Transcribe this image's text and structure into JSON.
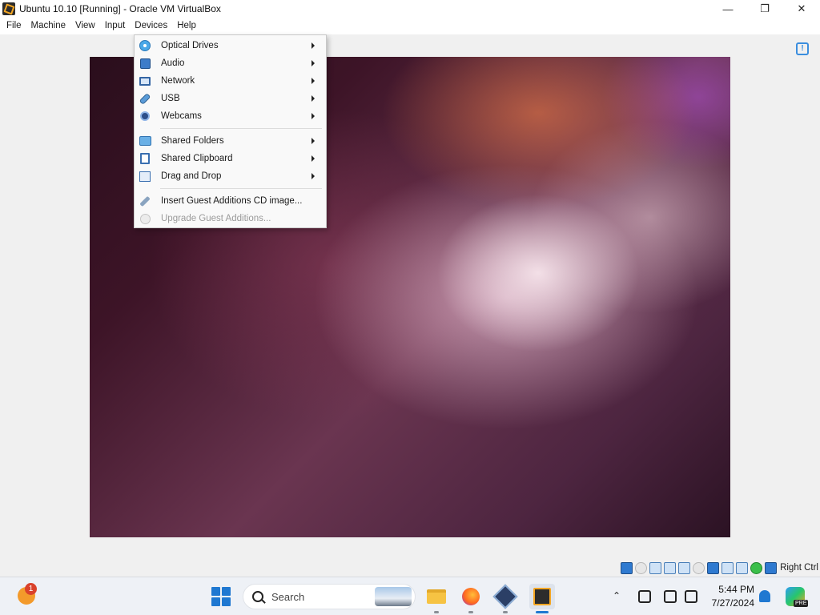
{
  "window": {
    "title": "Ubuntu 10.10 [Running] - Oracle VM VirtualBox",
    "icon": "virtualbox-vm-icon",
    "controls": {
      "minimize": "—",
      "maximize": "❐",
      "close": "✕"
    }
  },
  "menubar": {
    "items": [
      "File",
      "Machine",
      "View",
      "Input",
      "Devices",
      "Help"
    ],
    "active": "Devices"
  },
  "devices_menu": {
    "items": [
      {
        "label": "Optical Drives",
        "icon": "optical-disc-icon",
        "submenu": true,
        "enabled": true
      },
      {
        "label": "Audio",
        "icon": "audio-icon",
        "submenu": true,
        "enabled": true
      },
      {
        "label": "Network",
        "icon": "network-icon",
        "submenu": true,
        "enabled": true
      },
      {
        "label": "USB",
        "icon": "usb-icon",
        "submenu": true,
        "enabled": true
      },
      {
        "label": "Webcams",
        "icon": "webcam-icon",
        "submenu": true,
        "enabled": true
      },
      {
        "label": "Shared Folders",
        "icon": "shared-folder-icon",
        "submenu": true,
        "enabled": true
      },
      {
        "label": "Shared Clipboard",
        "icon": "clipboard-icon",
        "submenu": true,
        "enabled": true
      },
      {
        "label": "Drag and Drop",
        "icon": "drag-drop-icon",
        "submenu": true,
        "enabled": true
      },
      {
        "label": "Insert Guest Additions CD image...",
        "icon": "insert-cd-icon",
        "submenu": false,
        "enabled": true
      },
      {
        "label": "Upgrade Guest Additions...",
        "icon": "upgrade-icon",
        "submenu": false,
        "enabled": false
      }
    ]
  },
  "statusbar": {
    "host_key": "Right Ctrl",
    "indicators": [
      "hard-disk",
      "optical-drive",
      "audio",
      "network",
      "usb",
      "shared-folders",
      "display",
      "recording",
      "cpu",
      "mouse-integration",
      "guest-additions",
      "keyboard-capture"
    ]
  },
  "taskbar": {
    "weather_badge": "1",
    "search_placeholder": "Search",
    "apps": [
      "File Explorer",
      "Firefox",
      "VirtualBox",
      "Ubuntu 10.10 VM"
    ],
    "clock": {
      "time": "5:44 PM",
      "date": "7/27/2024"
    },
    "copilot_tag": "PRE"
  },
  "colors": {
    "accent": "#1f78d1",
    "vm_wallpaper_dark": "#2a0e1c",
    "vm_wallpaper_light": "#f2dce6"
  }
}
